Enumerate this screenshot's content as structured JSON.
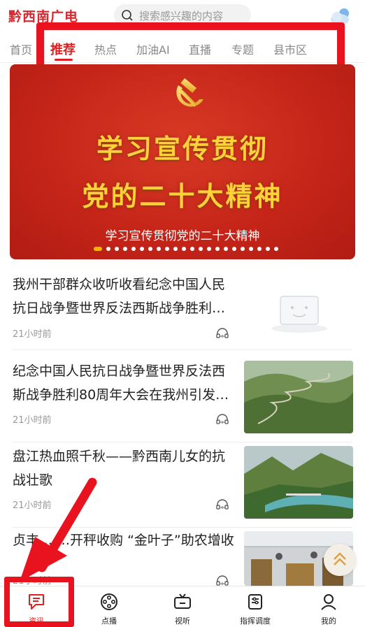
{
  "header": {
    "logo": "黔西南广电",
    "search_placeholder": "搜索感兴趣的内容"
  },
  "tabs": [
    {
      "label": "首页"
    },
    {
      "label": "推荐"
    },
    {
      "label": "热点"
    },
    {
      "label": "加油AI"
    },
    {
      "label": "直播"
    },
    {
      "label": "专题"
    },
    {
      "label": "县市区"
    }
  ],
  "active_tab": "推荐",
  "banner": {
    "line1": "学习宣传贯彻",
    "line2": "党的二十大精神",
    "caption": "学习宣传贯彻党的二十大精神",
    "slide_count": 22,
    "active_slide": 1
  },
  "news": [
    {
      "title": "我州干部群众收听收看纪念中国人民抗日战争暨世界反法西斯战争胜利…",
      "time": "21小时前",
      "thumb": "placeholder"
    },
    {
      "title": "纪念中国人民抗日战争暨世界反法西斯战争胜利80周年大会在我州引发…",
      "time": "21小时前",
      "thumb": "mountain-road"
    },
    {
      "title": "盘江热血照千秋——黔西南儿女的抗战壮歌",
      "time": "21小时前",
      "thumb": "river-bridge"
    },
    {
      "title": "贞丰… …开秤收购 “金叶子”助农增收",
      "time": "21小时前",
      "thumb": "tobacco-market"
    }
  ],
  "bottom_nav": [
    {
      "label": "资讯",
      "icon": "news-icon"
    },
    {
      "label": "点播",
      "icon": "film-reel-icon"
    },
    {
      "label": "视听",
      "icon": "tv-icon"
    },
    {
      "label": "指挥调度",
      "icon": "dispatch-icon"
    },
    {
      "label": "我的",
      "icon": "user-icon"
    }
  ],
  "colors": {
    "brand_red": "#e02020",
    "highlight_red": "#e8131f",
    "banner_gold": "#ffd23a"
  }
}
